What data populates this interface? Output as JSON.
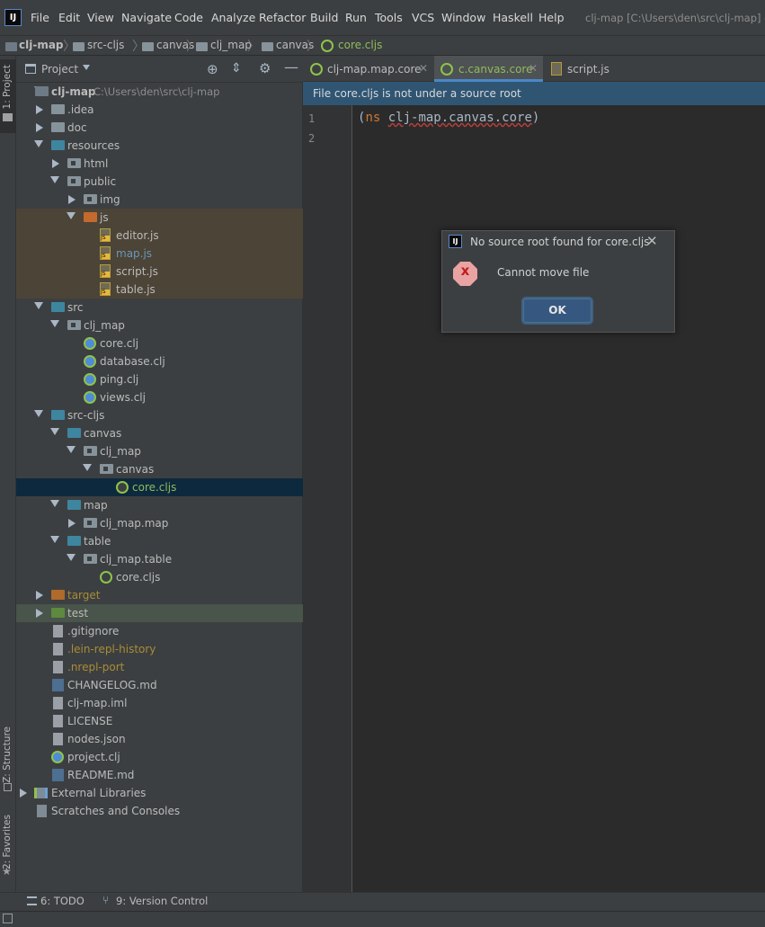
{
  "menubar": {
    "logo": "IJ",
    "items": [
      "File",
      "Edit",
      "View",
      "Navigate",
      "Code",
      "Analyze",
      "Refactor",
      "Build",
      "Run",
      "Tools",
      "VCS",
      "Window",
      "Haskell",
      "Help"
    ],
    "window_title": "clj-map [C:\\Users\\den\\src\\clj-map] - c"
  },
  "breadcrumb": [
    "clj-map",
    "src-cljs",
    "canvas",
    "clj_map",
    "canvas",
    "core.cljs"
  ],
  "left_stripe": {
    "project_tab": "1: Project",
    "structure_tab": "Z: Structure",
    "favorites_tab": "2: Favorites"
  },
  "project_panel": {
    "title": "Project",
    "tree": [
      {
        "label": "clj-map",
        "path": "C:\\Users\\den\\src\\clj-map"
      },
      {
        "label": ".idea"
      },
      {
        "label": "doc"
      },
      {
        "label": "resources"
      },
      {
        "label": "html"
      },
      {
        "label": "public"
      },
      {
        "label": "img"
      },
      {
        "label": "js"
      },
      {
        "label": "editor.js"
      },
      {
        "label": "map.js"
      },
      {
        "label": "script.js"
      },
      {
        "label": "table.js"
      },
      {
        "label": "src"
      },
      {
        "label": "clj_map"
      },
      {
        "label": "core.clj"
      },
      {
        "label": "database.clj"
      },
      {
        "label": "ping.clj"
      },
      {
        "label": "views.clj"
      },
      {
        "label": "src-cljs"
      },
      {
        "label": "canvas"
      },
      {
        "label": "clj_map"
      },
      {
        "label": "canvas"
      },
      {
        "label": "core.cljs"
      },
      {
        "label": "map"
      },
      {
        "label": "clj_map.map"
      },
      {
        "label": "table"
      },
      {
        "label": "clj_map.table"
      },
      {
        "label": "core.cljs"
      },
      {
        "label": "target"
      },
      {
        "label": "test"
      },
      {
        "label": ".gitignore"
      },
      {
        "label": ".lein-repl-history"
      },
      {
        "label": ".nrepl-port"
      },
      {
        "label": "CHANGELOG.md"
      },
      {
        "label": "clj-map.iml"
      },
      {
        "label": "LICENSE"
      },
      {
        "label": "nodes.json"
      },
      {
        "label": "project.clj"
      },
      {
        "label": "README.md"
      },
      {
        "label": "External Libraries"
      },
      {
        "label": "Scratches and Consoles"
      }
    ]
  },
  "editor": {
    "tabs": [
      "clj-map.map.core",
      "c.canvas.core",
      "script.js"
    ],
    "notification": "File core.cljs is not under a source root",
    "line_numbers": [
      "1",
      "2"
    ],
    "code": {
      "open": "(",
      "keyword": "ns",
      "space": " ",
      "namespace": "clj-map.canvas.core",
      "close": ")"
    }
  },
  "dialog": {
    "title": "No source root found for core.cljs",
    "message": "Cannot move file",
    "ok_label": "OK",
    "error_glyph": "x"
  },
  "bottom_bar": {
    "todo_label": "6: TODO",
    "vcs_label": "9: Version Control"
  },
  "colors": {
    "selection": "#0d293e",
    "resources_highlight": "#4c4437",
    "test_highlight": "#49544a",
    "excluded_text": "#a98c35",
    "notification_bg": "#2f5573",
    "ok_button": "#365880"
  }
}
